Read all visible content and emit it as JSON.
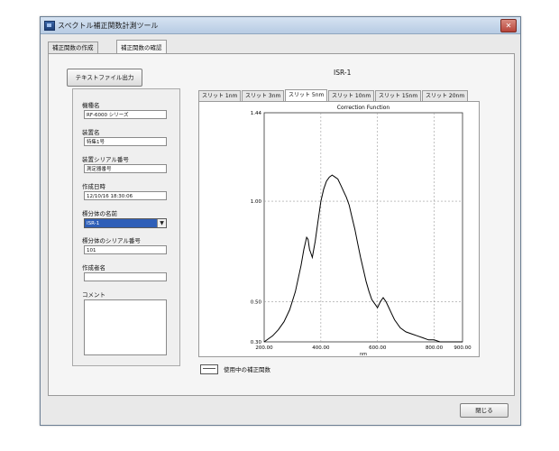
{
  "window": {
    "title": "スペクトル補正関数計測ツール",
    "close_glyph": "✕"
  },
  "tabs": [
    {
      "label": "補正関数の作成"
    },
    {
      "label": "補正関数の確認"
    }
  ],
  "toolbar": {
    "export_label": "テキストファイル出力"
  },
  "info": {
    "model_label": "機種名",
    "model_value": "RF-6000 シリーズ",
    "device_label": "装置名",
    "device_value": "特集1号",
    "serial_label": "装置シリアル番号",
    "serial_value": "測定器番号",
    "created_label": "作成日時",
    "created_value": "12/10/16 18:30:06",
    "standard_label": "標分体の名前",
    "standard_value": "ISR-1",
    "standard_serial_label": "標分体のシリアル番号",
    "standard_serial_value": "101",
    "author_label": "作成者名",
    "author_value": "",
    "comment_label": "コメント",
    "comment_value": ""
  },
  "plot": {
    "title": "ISR-1",
    "slit_tabs": [
      {
        "label": "スリット 1nm"
      },
      {
        "label": "スリット 3nm"
      },
      {
        "label": "スリット 5nm"
      },
      {
        "label": "スリット 10nm"
      },
      {
        "label": "スリット 15nm"
      },
      {
        "label": "スリット 20nm"
      }
    ],
    "active_slit_index": 2
  },
  "legend": {
    "label": "使用中の補正関数"
  },
  "footer": {
    "close_label": "閉じる"
  },
  "colors": {
    "titlebar": "#c6d6ea",
    "selection": "#2f5fb8",
    "curve": "#000000",
    "grid": "#9a9a9a"
  },
  "chart_data": {
    "type": "line",
    "title": "Correction Function",
    "xlabel": "nm",
    "ylabel": "",
    "xlim": [
      200,
      900
    ],
    "ylim": [
      0.3,
      1.44
    ],
    "x_ticks": [
      "200.00",
      "400.00",
      "600.00",
      "800.00",
      "900.00"
    ],
    "y_ticks": [
      "0.30",
      "0.50",
      "1.00",
      "1.44"
    ],
    "grid": true,
    "series": [
      {
        "name": "",
        "x": [
          200,
          230,
          250,
          270,
          290,
          310,
          330,
          340,
          350,
          355,
          360,
          365,
          370,
          380,
          390,
          400,
          410,
          420,
          430,
          440,
          450,
          460,
          470,
          480,
          490,
          500,
          510,
          520,
          530,
          540,
          550,
          560,
          570,
          580,
          590,
          600,
          610,
          620,
          630,
          640,
          650,
          660,
          680,
          700,
          720,
          740,
          760,
          780,
          800,
          820,
          840,
          860,
          880,
          900
        ],
        "y": [
          0.3,
          0.33,
          0.36,
          0.4,
          0.46,
          0.55,
          0.68,
          0.76,
          0.82,
          0.81,
          0.76,
          0.74,
          0.72,
          0.8,
          0.9,
          1.0,
          1.06,
          1.1,
          1.12,
          1.13,
          1.12,
          1.11,
          1.08,
          1.05,
          1.02,
          0.98,
          0.92,
          0.86,
          0.79,
          0.72,
          0.66,
          0.6,
          0.55,
          0.51,
          0.49,
          0.47,
          0.5,
          0.52,
          0.5,
          0.47,
          0.44,
          0.41,
          0.37,
          0.35,
          0.34,
          0.33,
          0.32,
          0.31,
          0.31,
          0.3,
          0.3,
          0.3,
          0.3,
          0.3
        ]
      }
    ]
  }
}
